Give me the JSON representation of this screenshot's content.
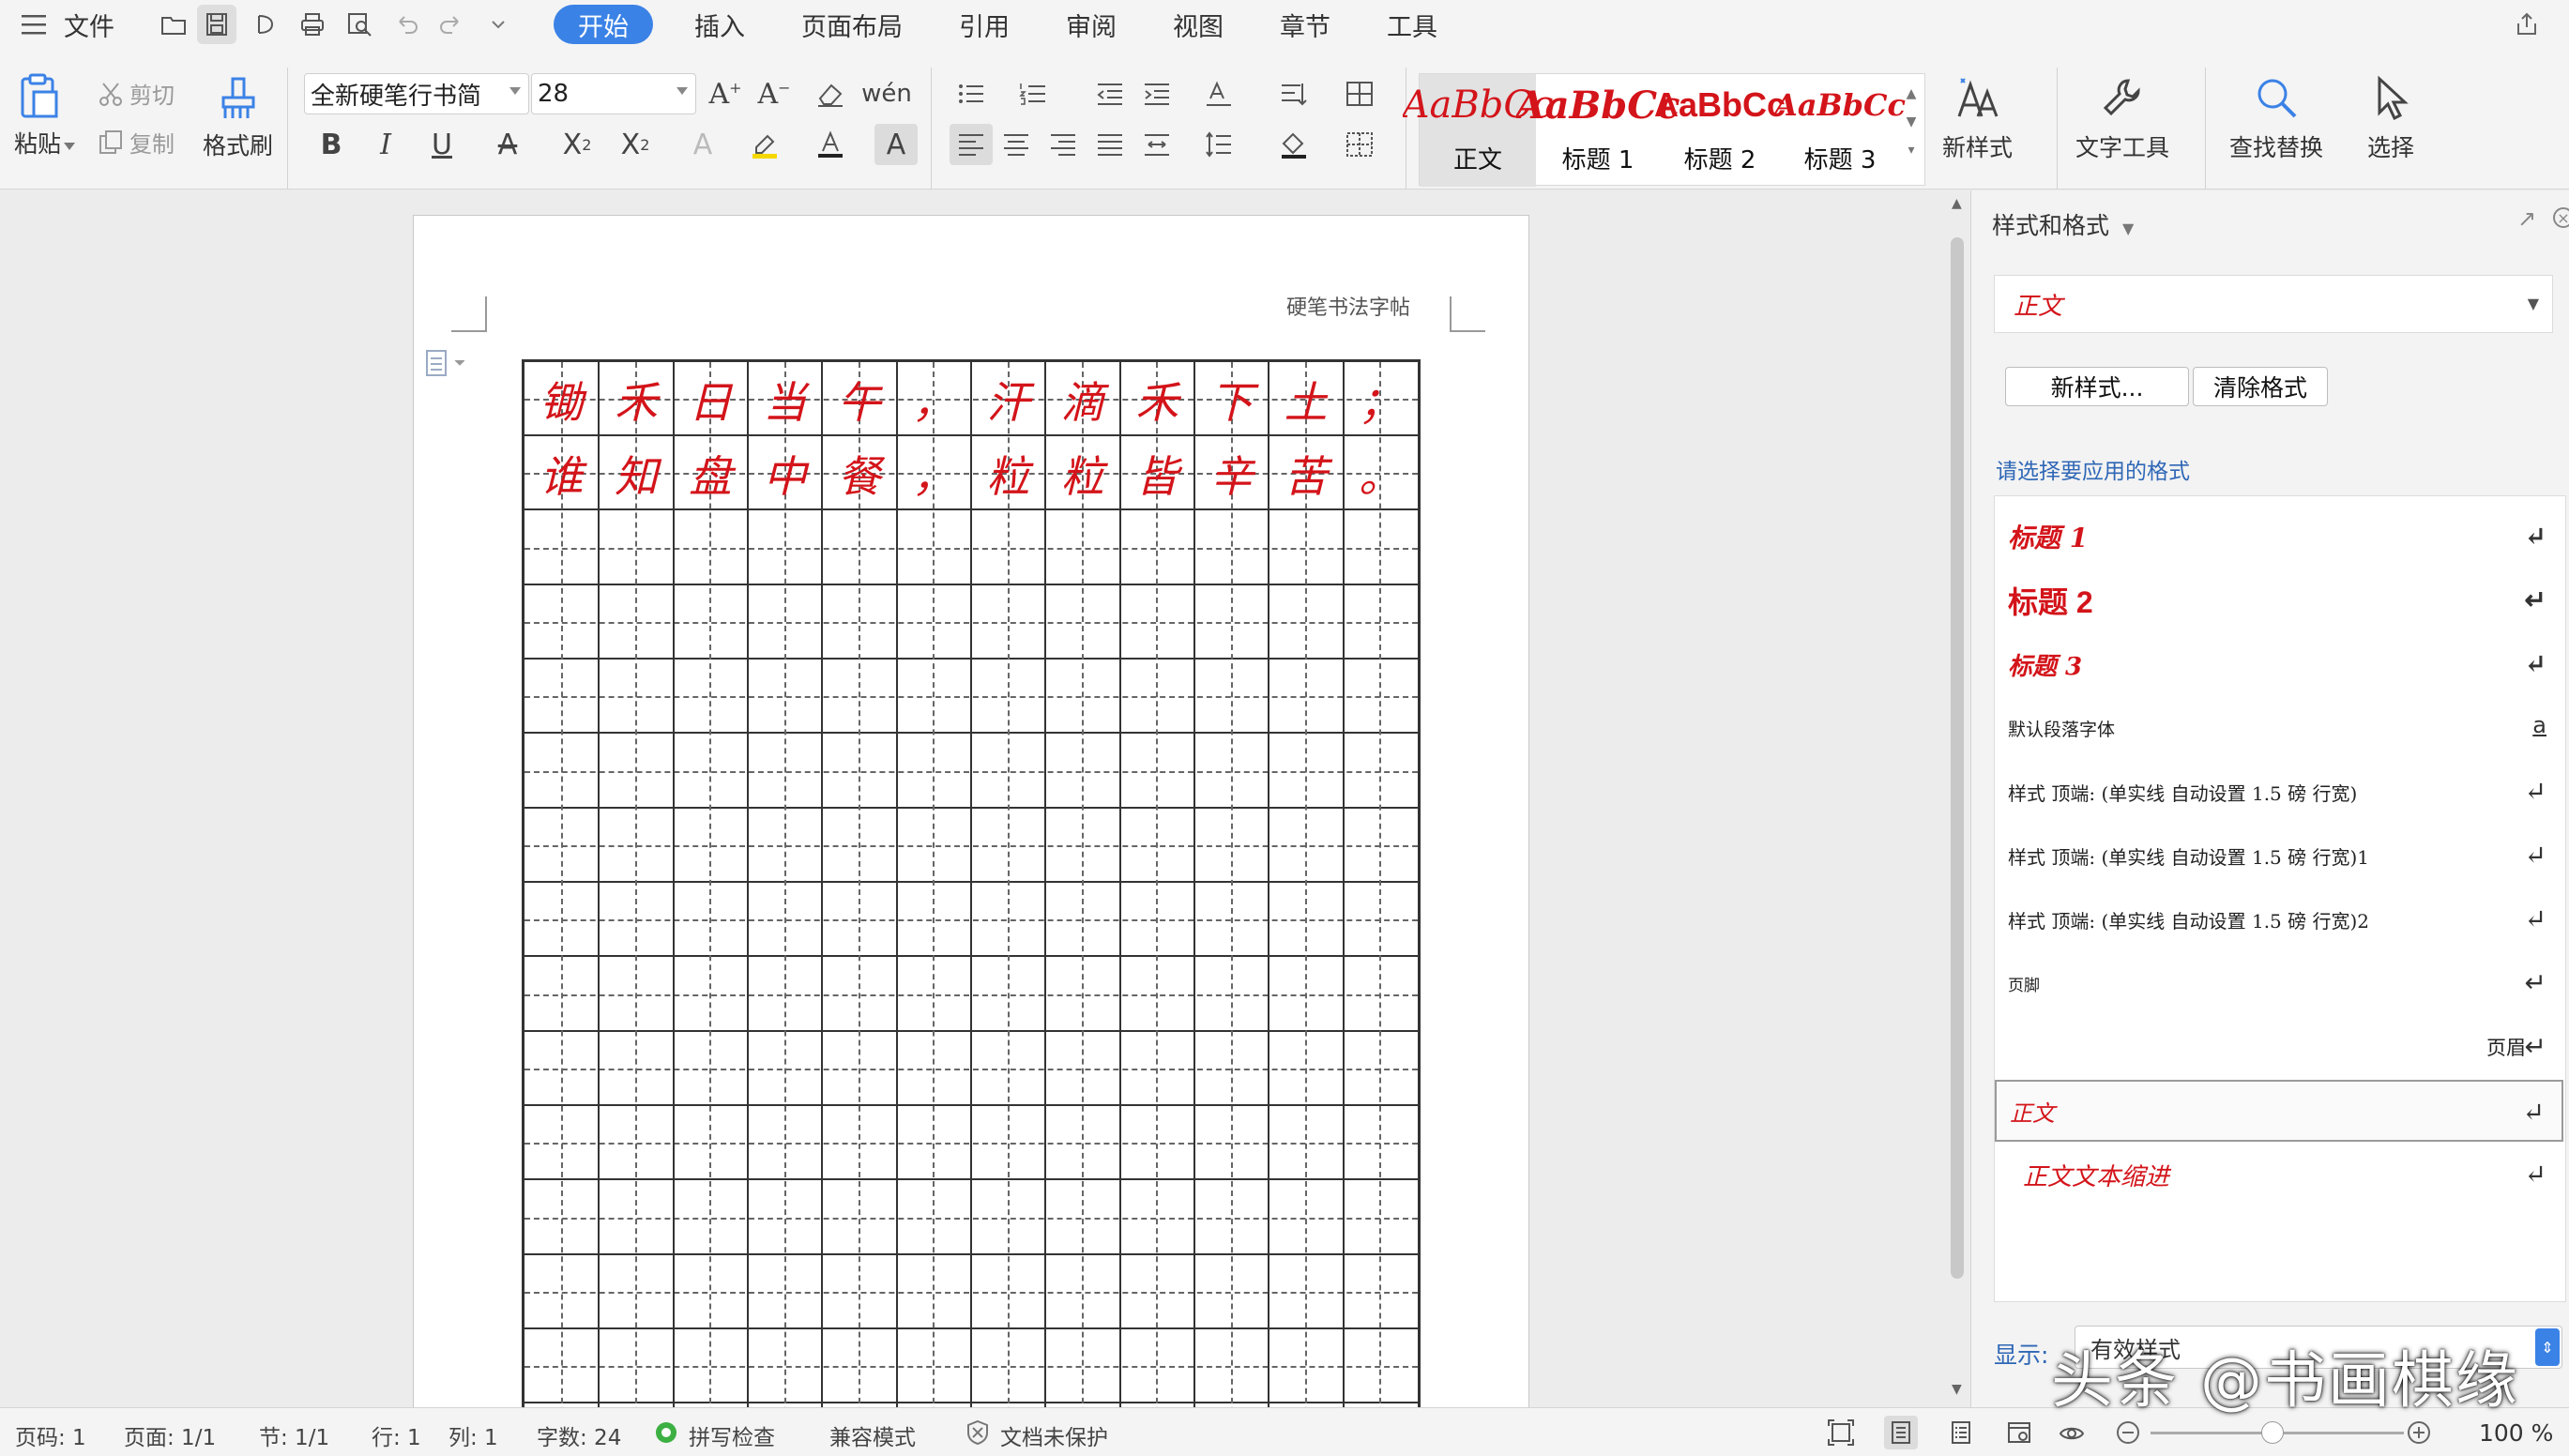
{
  "menubar": {
    "file_label": "文件",
    "tabs": [
      {
        "label": "开始",
        "active": true
      },
      {
        "label": "插入"
      },
      {
        "label": "页面布局"
      },
      {
        "label": "引用"
      },
      {
        "label": "审阅"
      },
      {
        "label": "视图"
      },
      {
        "label": "章节"
      },
      {
        "label": "工具"
      }
    ]
  },
  "ribbon": {
    "paste_label": "粘贴",
    "cut_label": "剪切",
    "copy_label": "复制",
    "format_painter_label": "格式刷",
    "font_name": "全新硬笔行书简",
    "font_size": "28",
    "new_style_label": "新样式",
    "text_tools_label": "文字工具",
    "find_replace_label": "查找替换",
    "select_label": "选择",
    "gallery": [
      {
        "preview": "AaBbCc",
        "label": "正文",
        "color": "#d3141a",
        "selected": true
      },
      {
        "preview": "AaBbCc",
        "label": "标题 1",
        "color": "#d3141a"
      },
      {
        "preview": "AaBbCc",
        "label": "标题 2",
        "color": "#d3141a"
      },
      {
        "preview": "AaBbCc",
        "label": "标题 3",
        "color": "#d3141a"
      }
    ]
  },
  "document": {
    "header_text": "硬笔书法字帖",
    "line1": [
      "锄",
      "禾",
      "日",
      "当",
      "午",
      "，",
      "汗",
      "滴",
      "禾",
      "下",
      "土",
      "；"
    ],
    "line2": [
      "谁",
      "知",
      "盘",
      "中",
      "餐",
      "，",
      "粒",
      "粒",
      "皆",
      "辛",
      "苦",
      "。"
    ],
    "text_color": "#d3141a"
  },
  "panel": {
    "title": "样式和格式",
    "current_style": "正文",
    "new_style_button": "新样式...",
    "clear_format_button": "清除格式",
    "choose_label": "请选择要应用的格式",
    "styles": [
      {
        "label": "标题 1",
        "mark": "↵"
      },
      {
        "label": "标题 2",
        "mark": "↵"
      },
      {
        "label": "标题 3",
        "mark": "↵"
      },
      {
        "label": "默认段落字体",
        "mark": "a"
      },
      {
        "label": "样式 顶端: (单实线 自动设置 1.5 磅 行宽)",
        "mark": "↵"
      },
      {
        "label": "样式 顶端: (单实线 自动设置 1.5 磅 行宽)1",
        "mark": "↵"
      },
      {
        "label": "样式 顶端: (单实线 自动设置 1.5 磅 行宽)2",
        "mark": "↵"
      },
      {
        "label": "页脚",
        "mark": "↵"
      },
      {
        "label": "页眉",
        "mark": "↵"
      },
      {
        "label": "正文",
        "mark": "↵"
      },
      {
        "label": "正文文本缩进",
        "mark": "↵"
      }
    ],
    "show_label": "显示:",
    "show_value": "有效样式"
  },
  "statusbar": {
    "page_num": "页码: 1",
    "pages": "页面: 1/1",
    "section": "节: 1/1",
    "row": "行: 1",
    "col": "列: 1",
    "word_count": "字数: 24",
    "spell_check": "拼写检查",
    "compat_mode": "兼容模式",
    "doc_protect": "文档未保护",
    "zoom": "100 %"
  },
  "watermark": "头条 @书画棋缘"
}
